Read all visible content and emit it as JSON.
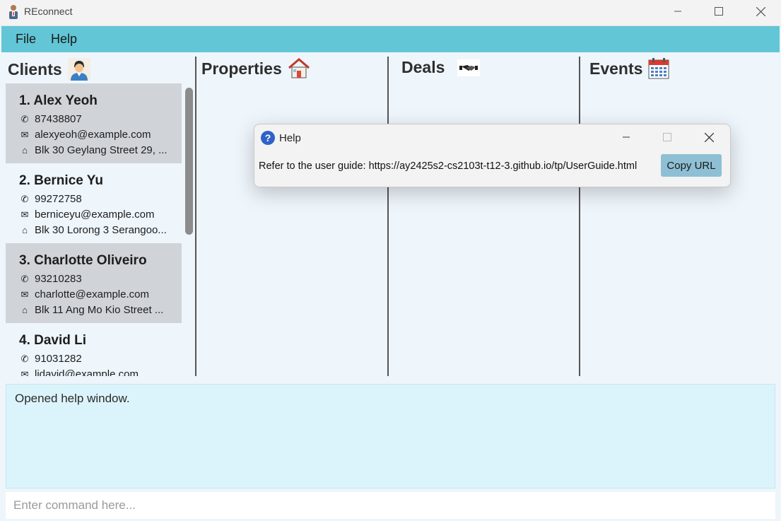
{
  "window": {
    "title": "REconnect"
  },
  "menu": {
    "file": "File",
    "help": "Help"
  },
  "columns": {
    "clients": "Clients",
    "properties": "Properties",
    "deals": "Deals",
    "events": "Events"
  },
  "clients": [
    {
      "name": "1. Alex Yeoh",
      "phone": "87438807",
      "email": "alexyeoh@example.com",
      "address": "Blk 30 Geylang Street 29, ..."
    },
    {
      "name": "2. Bernice Yu",
      "phone": "99272758",
      "email": "berniceyu@example.com",
      "address": "Blk 30 Lorong 3 Serangoo..."
    },
    {
      "name": "3. Charlotte Oliveiro",
      "phone": "93210283",
      "email": "charlotte@example.com",
      "address": "Blk 11 Ang Mo Kio Street ..."
    },
    {
      "name": "4. David Li",
      "phone": "91031282",
      "email": "lidavid@example.com",
      "address": ""
    }
  ],
  "result": {
    "text": "Opened help window."
  },
  "command": {
    "placeholder": "Enter command here..."
  },
  "help_dialog": {
    "title": "Help",
    "message": "Refer to the user guide: https://ay2425s2-cs2103t-t12-3.github.io/tp/UserGuide.html",
    "copy_button": "Copy URL"
  }
}
